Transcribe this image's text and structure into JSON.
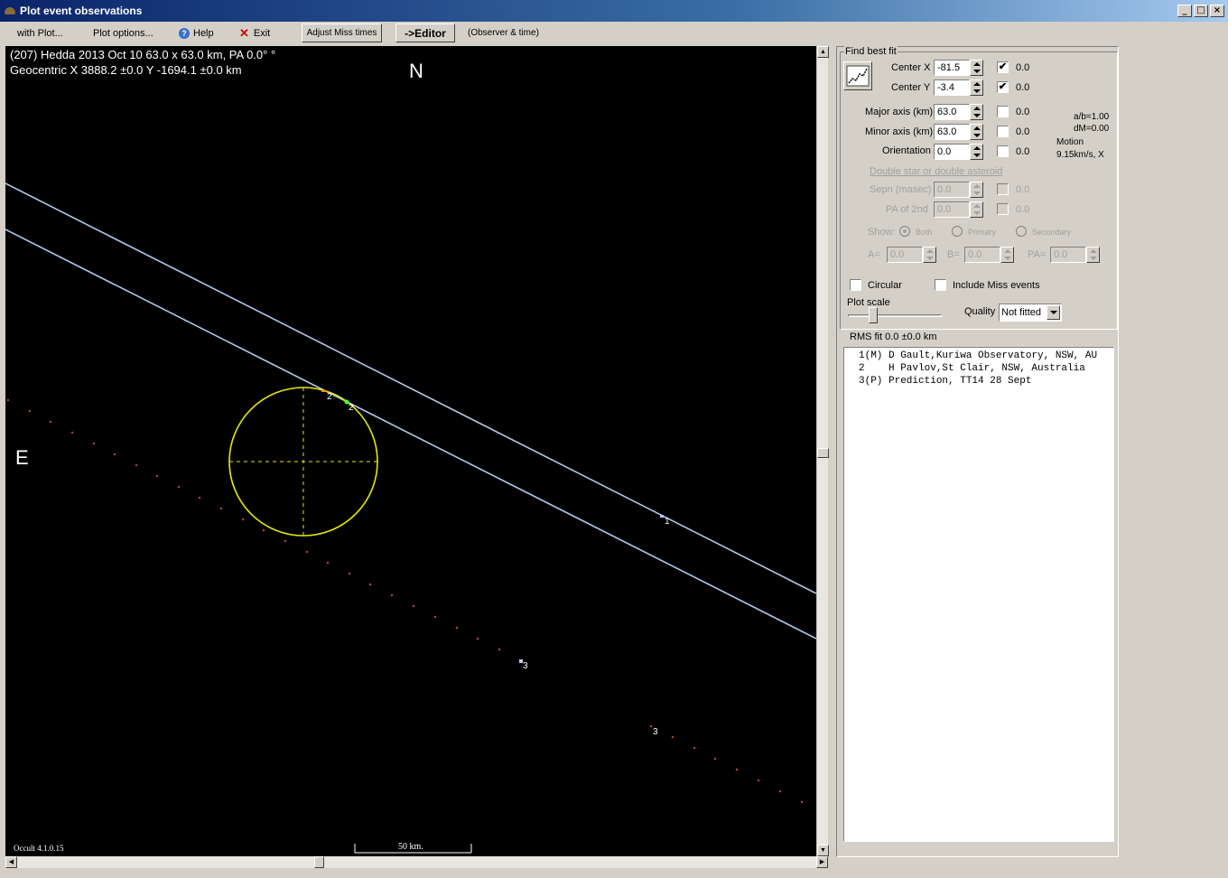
{
  "window": {
    "title": "Plot event observations",
    "controls": {
      "minimize": "_",
      "maximize": "□",
      "close": "×"
    }
  },
  "menu": {
    "with_plot": "with Plot...",
    "plot_options": "Plot options...",
    "help": "Help",
    "exit": "Exit",
    "adjust_miss": "Adjust Miss times",
    "editor": "->Editor",
    "observer_time": "(Observer & time)"
  },
  "plot": {
    "header_line1": "(207) Hedda  2013 Oct 10   63.0 x 63.0 km, PA 0.0° °",
    "header_line2": "Geocentric X  3888.2 ±0.0  Y -1694.1 ±0.0 km",
    "north_label": "N",
    "east_label": "E",
    "version": "Occult 4.1.0.15",
    "scale_label": "50 km.",
    "chord_labels": {
      "1": "1",
      "2a": "2",
      "2b": "2",
      "3a": "3",
      "3b": "3"
    },
    "colors": {
      "background": "#000000",
      "chord": "#b0c8e8",
      "ellipse": "#e8e800",
      "miss_dots": "#c04040"
    }
  },
  "fit": {
    "group_title": "Find best fit",
    "center_x_label": "Center X",
    "center_x_value": "-81.5",
    "center_x_checked": true,
    "center_x_offset": "0.0",
    "center_y_label": "Center Y",
    "center_y_value": "-3.4",
    "center_y_checked": true,
    "center_y_offset": "0.0",
    "major_label": "Major axis (km)",
    "major_value": "63.0",
    "major_offset": "0.0",
    "minor_label": "Minor axis (km)",
    "minor_value": "63.0",
    "minor_offset": "0.0",
    "orient_label": "Orientation",
    "orient_value": "0.0",
    "orient_offset": "0.0",
    "ab_ratio": "a/b=1.00",
    "dm": "dM=0.00",
    "motion_label": "Motion",
    "motion_value": "9.15km/s, X",
    "double_title": "Double star  or  double asteroid",
    "sepn_label": "Sepn (masec)",
    "sepn_value": "0.0",
    "sepn_offset": "0.0",
    "pa2_label": "PA of 2nd",
    "pa2_value": "0.0",
    "pa2_offset": "0.0",
    "show_label": "Show:",
    "show_both": "Both",
    "show_primary": "Primary",
    "show_secondary": "Secondary",
    "a_label": "A=",
    "a_value": "0.0",
    "b_label": "B=",
    "b_value": "0.0",
    "pa_label": "PA=",
    "pa_value": "0.0"
  },
  "options": {
    "circular": "Circular",
    "include_miss": "Include Miss events",
    "plot_scale": "Plot scale",
    "quality_label": "Quality",
    "quality_value": "Not fitted",
    "rms": "RMS fit 0.0 ±0.0 km"
  },
  "observers": [
    "1(M) D Gault,Kuriwa Observatory, NSW, AU",
    "2    H Pavlov,St Clair, NSW, Australia",
    "3(P) Prediction, TT14 28 Sept"
  ]
}
